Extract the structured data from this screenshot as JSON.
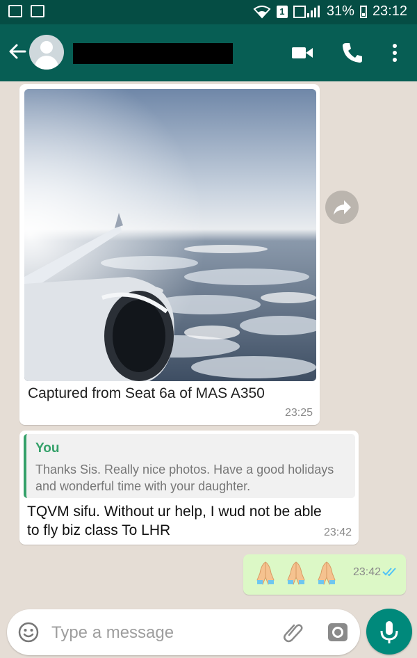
{
  "status_bar": {
    "battery": "31%",
    "time": "23:12",
    "sim_slot": "1",
    "icons": [
      "image-icon",
      "checkbox-icon",
      "wifi-icon",
      "sim-icon",
      "signal-icon",
      "battery-icon"
    ]
  },
  "header": {
    "contact_name": "[redacted]",
    "icons": [
      "back-arrow-icon",
      "avatar-icon",
      "video-call-icon",
      "phone-icon",
      "more-vert-icon"
    ]
  },
  "messages": [
    {
      "type": "image",
      "direction": "incoming",
      "caption": "Captured from Seat 6a of MAS A350",
      "time": "23:25"
    },
    {
      "type": "reply",
      "direction": "incoming",
      "quote_author": "You",
      "quote_text": "Thanks Sis. Really nice photos. Have a good holidays and wonderful time with your daughter.",
      "text": "TQVM  sifu. Without ur help, I wud not be able to fly biz class To LHR",
      "time": "23:42"
    },
    {
      "type": "emoji",
      "direction": "outgoing",
      "emoji_count": 3,
      "emoji": "folded-hands",
      "time": "23:42",
      "status": "read"
    }
  ],
  "composer": {
    "placeholder": "Type a message",
    "icons": [
      "emoji-icon",
      "paperclip-icon",
      "camera-icon",
      "mic-icon"
    ]
  },
  "colors": {
    "status_bar": "#054d44",
    "app_bar": "#075e54",
    "chat_bg": "#e5ddd5",
    "incoming_bubble": "#ffffff",
    "outgoing_bubble": "#dcf8c6",
    "quote_accent": "#35a16a",
    "mic_button": "#00897b",
    "read_ticks": "#4fc3f7"
  }
}
